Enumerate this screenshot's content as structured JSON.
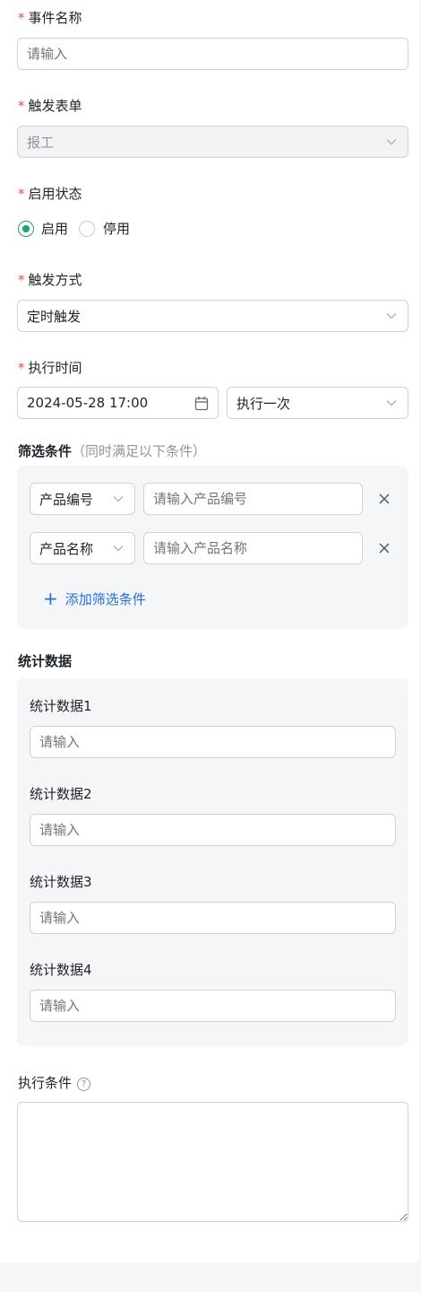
{
  "form": {
    "event_name": {
      "label": "事件名称",
      "required": "*",
      "placeholder": "请输入"
    },
    "trigger_form": {
      "label": "触发表单",
      "required": "*",
      "value": "报工"
    },
    "status": {
      "label": "启用状态",
      "required": "*",
      "options": [
        "启用",
        "停用"
      ],
      "selected": "启用"
    },
    "trigger_method": {
      "label": "触发方式",
      "required": "*",
      "value": "定时触发"
    },
    "exec_time": {
      "label": "执行时间",
      "required": "*",
      "datetime": "2024-05-28 17:00",
      "frequency": "执行一次"
    },
    "filter": {
      "title": "筛选条件",
      "hint": "（同时满足以下条件）",
      "rows": [
        {
          "field": "产品编号",
          "placeholder": "请输入产品编号"
        },
        {
          "field": "产品名称",
          "placeholder": "请输入产品名称"
        }
      ],
      "add_label": "添加筛选条件",
      "add_symbol": "+"
    },
    "stats": {
      "title": "统计数据",
      "items": [
        {
          "label": "统计数据1",
          "placeholder": "请输入"
        },
        {
          "label": "统计数据2",
          "placeholder": "请输入"
        },
        {
          "label": "统计数据3",
          "placeholder": "请输入"
        },
        {
          "label": "统计数据4",
          "placeholder": "请输入"
        }
      ]
    },
    "exec_condition": {
      "label": "执行条件",
      "help": "?"
    }
  },
  "colors": {
    "required": "#f54a45",
    "accent": "#1aa36b",
    "link": "#1f6fe0"
  }
}
